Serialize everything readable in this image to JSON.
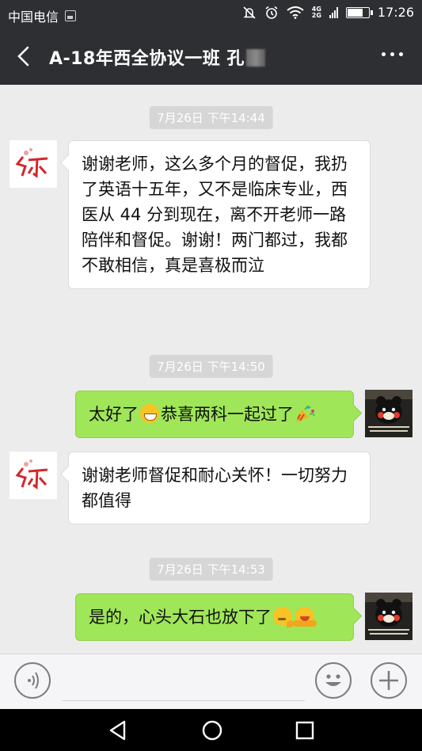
{
  "status_bar": {
    "carrier": "中国电信",
    "network_top": "4G",
    "network_bottom": "2G",
    "time": "17:26",
    "battery_level": 0.7
  },
  "header": {
    "back_icon": "back-arrow-icon",
    "title": "A-18年西全协议一班 孔",
    "more_icon": "more-icon"
  },
  "messages": [
    {
      "type": "timestamp",
      "text": "7月26日 下午14:44"
    },
    {
      "type": "incoming",
      "text": "谢谢老师，这么多个月的督促，我扔了英语十五年，又不是临床专业，西医从 44 分到现在，离不开老师一路陪伴和督促。谢谢！两门都过，我都不敢相信，真是喜极而泣"
    },
    {
      "type": "timestamp",
      "text": "7月26日 下午14:50"
    },
    {
      "type": "outgoing",
      "text_a": "太好了",
      "text_b": "恭喜两科一起过了",
      "emojis": [
        "grin-emoji",
        "party-popper-emoji"
      ]
    },
    {
      "type": "incoming",
      "text": "谢谢老师督促和耐心关怀！一切努力都值得"
    },
    {
      "type": "timestamp",
      "text": "7月26日 下午14:53"
    },
    {
      "type": "outgoing",
      "text_a": "是的，心头大石也放下了",
      "emojis": [
        "thinking-emoji",
        "hugging-emoji"
      ]
    }
  ],
  "input_bar": {
    "voice_icon": "voice-icon",
    "emoji_icon": "emoji-icon",
    "plus_icon": "plus-icon"
  },
  "nav_bar": {
    "back": "nav-back-icon",
    "home": "nav-home-icon",
    "recents": "nav-recents-icon"
  }
}
